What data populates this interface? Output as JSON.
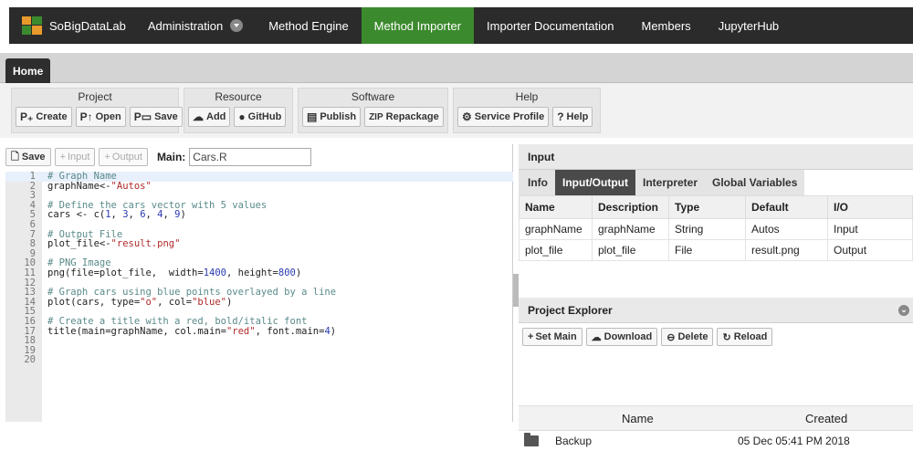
{
  "nav": {
    "brand": "SoBigDataLab",
    "items": [
      {
        "label": "Administration",
        "has_dropdown": true,
        "active": false
      },
      {
        "label": "Method Engine",
        "active": false
      },
      {
        "label": "Method Importer",
        "active": true
      },
      {
        "label": "Importer Documentation",
        "active": false
      },
      {
        "label": "Members",
        "active": false
      },
      {
        "label": "JupyterHub",
        "active": false
      }
    ],
    "active_color": "#3c8a2e"
  },
  "home_tab": "Home",
  "ribbon": {
    "project": {
      "title": "Project",
      "create": "Create",
      "open": "Open",
      "save": "Save"
    },
    "resource": {
      "title": "Resource",
      "add": "Add",
      "github": "GitHub"
    },
    "software": {
      "title": "Software",
      "publish": "Publish",
      "repackage": "Repackage",
      "zip_icon": "ZIP"
    },
    "help": {
      "title": "Help",
      "service_profile": "Service Profile",
      "help": "Help"
    }
  },
  "editor": {
    "save": "Save",
    "input": "Input",
    "output": "Output",
    "main_label": "Main:",
    "main_value": "Cars.R",
    "lines": [
      "# Graph Name",
      "graphName<-\"Autos\"",
      "",
      "# Define the cars vector with 5 values",
      "cars <- c(1, 3, 6, 4, 9)",
      "",
      "# Output File",
      "plot_file<-\"result.png\"",
      "",
      "# PNG Image",
      "png(file=plot_file,  width=1400, height=800)",
      "",
      "# Graph cars using blue points overlayed by a line",
      "plot(cars, type=\"o\", col=\"blue\")",
      "",
      "# Create a title with a red, bold/italic font",
      "title(main=graphName, col.main=\"red\", font.main=4)",
      "",
      "",
      ""
    ]
  },
  "input_panel": {
    "title": "Input",
    "tabs": [
      {
        "label": "Info",
        "active": false
      },
      {
        "label": "Input/Output",
        "active": true
      },
      {
        "label": "Interpreter",
        "active": false
      },
      {
        "label": "Global Variables",
        "active": false
      }
    ],
    "columns": [
      "Name",
      "Description",
      "Type",
      "Default",
      "I/O"
    ],
    "rows": [
      [
        "graphName",
        "graphName",
        "String",
        "Autos",
        "Input"
      ],
      [
        "plot_file",
        "plot_file",
        "File",
        "result.png",
        "Output"
      ]
    ]
  },
  "explorer": {
    "title": "Project Explorer",
    "set_main": "Set Main",
    "download": "Download",
    "delete": "Delete",
    "reload": "Reload",
    "col_name": "Name",
    "col_created": "Created",
    "items": [
      {
        "name": "Backup",
        "created": "05 Dec 05:41 PM 2018"
      }
    ]
  }
}
